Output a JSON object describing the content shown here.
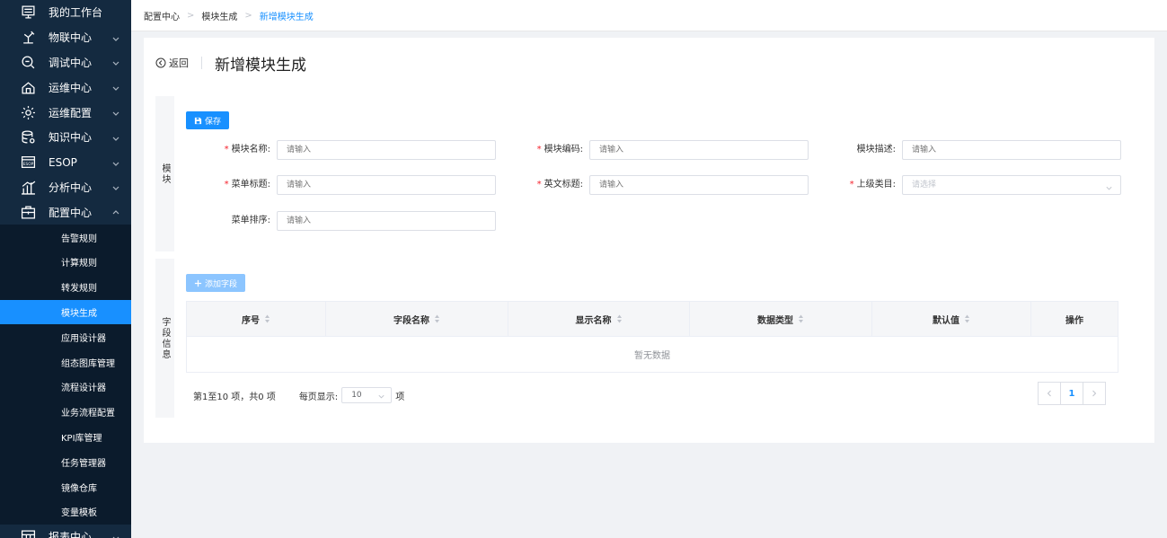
{
  "sidebar": {
    "items": [
      {
        "label": "我的工作台",
        "icon": "workbench-icon",
        "arrow": false
      },
      {
        "label": "物联中心",
        "icon": "iot-icon",
        "arrow": true
      },
      {
        "label": "调试中心",
        "icon": "debug-icon",
        "arrow": true
      },
      {
        "label": "运维中心",
        "icon": "ops-home-icon",
        "arrow": true
      },
      {
        "label": "运维配置",
        "icon": "gear-icon",
        "arrow": true
      },
      {
        "label": "知识中心",
        "icon": "database-icon",
        "arrow": true
      },
      {
        "label": "ESOP",
        "icon": "esop-icon",
        "arrow": true
      },
      {
        "label": "分析中心",
        "icon": "bar-chart-icon",
        "arrow": true
      },
      {
        "label": "配置中心",
        "icon": "config-box-icon",
        "arrow": true,
        "expanded": true
      }
    ],
    "sub_items": [
      {
        "label": "告警规则"
      },
      {
        "label": "计算规则"
      },
      {
        "label": "转发规则"
      },
      {
        "label": "模块生成",
        "active": true
      },
      {
        "label": "应用设计器"
      },
      {
        "label": "组态图库管理"
      },
      {
        "label": "流程设计器"
      },
      {
        "label": "业务流程配置"
      },
      {
        "label": "KPI库管理"
      },
      {
        "label": "任务管理器"
      },
      {
        "label": "镜像仓库"
      },
      {
        "label": "变量模板"
      }
    ],
    "bottom_item": {
      "label": "报表中心",
      "icon": "report-icon"
    },
    "bg_color": "#142a40",
    "active_color": "#1890ff"
  },
  "breadcrumb": [
    "配置中心",
    "模块生成",
    "新增模块生成"
  ],
  "header": {
    "back_label": "返回",
    "title": "新增模块生成"
  },
  "module_section": {
    "label": "模块",
    "save_label": "保存",
    "fields": {
      "module_name": {
        "label": "模块名称:",
        "required": true,
        "placeholder": "请输入"
      },
      "module_code": {
        "label": "模块编码:",
        "required": true,
        "placeholder": "请输入"
      },
      "module_desc": {
        "label": "模块描述:",
        "required": false,
        "placeholder": "请输入"
      },
      "menu_title": {
        "label": "菜单标题:",
        "required": true,
        "placeholder": "请输入"
      },
      "en_title": {
        "label": "英文标题:",
        "required": true,
        "placeholder": "请输入"
      },
      "parent_category": {
        "label": "上级类目:",
        "required": true,
        "placeholder": "请选择"
      },
      "menu_order": {
        "label": "菜单排序:",
        "required": false,
        "placeholder": "请输入"
      }
    }
  },
  "fields_section": {
    "label": "字段信息",
    "add_label": "添加字段",
    "columns": [
      {
        "label": "序号",
        "sortable": true
      },
      {
        "label": "字段名称",
        "sortable": true
      },
      {
        "label": "显示名称",
        "sortable": true
      },
      {
        "label": "数据类型",
        "sortable": true
      },
      {
        "label": "默认值",
        "sortable": true
      },
      {
        "label": "操作",
        "sortable": false
      }
    ],
    "empty_text": "暂无数据",
    "pagination": {
      "range_text": "第1至10 项，共0 项",
      "page_size_label": "每页显示:",
      "page_size": "10",
      "unit": "项",
      "current_page": "1"
    }
  },
  "colors": {
    "primary": "#1890ff",
    "required": "#f5222d"
  }
}
